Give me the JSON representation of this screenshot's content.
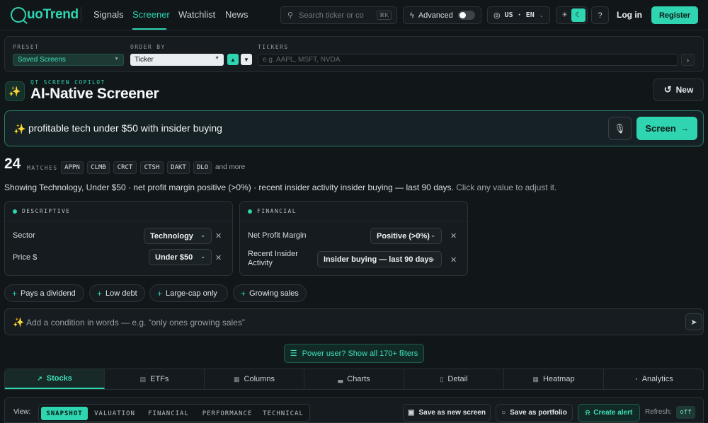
{
  "brand": {
    "logo_text": "uoTrend"
  },
  "nav": {
    "items": [
      "Signals",
      "Screener",
      "Watchlist",
      "News"
    ],
    "active": "Screener"
  },
  "search": {
    "placeholder": "Search ticker or co",
    "shortcut": "⌘K"
  },
  "advanced": {
    "label": "Advanced",
    "enabled": false
  },
  "locale": {
    "label": "US · EN"
  },
  "auth": {
    "login": "Log in",
    "register": "Register"
  },
  "presets": {
    "preset_label": "PRESET",
    "preset_value": "Saved Screens",
    "order_label": "ORDER BY",
    "order_value": "Ticker",
    "asc_glyph": "▲",
    "desc_glyph": "▼",
    "tickers_label": "TICKERS",
    "tickers_placeholder": "e.g. AAPL, MSFT, NVDA",
    "go_glyph": "›"
  },
  "copilot": {
    "eyebrow": "QT SCREEN COPILOT",
    "title": "AI-Native Screener",
    "new_label": "New"
  },
  "query": {
    "text": "profitable tech under $50 with insider buying",
    "screen_label": "Screen"
  },
  "matches": {
    "count": "24",
    "label": "MATCHES",
    "tickers": [
      "APPN",
      "CLMB",
      "CRCT",
      "CTSH",
      "DAKT",
      "DLO"
    ],
    "more": "and more"
  },
  "summary": {
    "text": "Showing Technology, Under $50 · net profit margin positive (>0%) · recent insider activity insider buying — last 90 days.",
    "hint": "Click any value to adjust it."
  },
  "filters": {
    "descriptive": {
      "title": "DESCRIPTIVE",
      "rows": [
        {
          "label": "Sector",
          "value": "Technology"
        },
        {
          "label": "Price $",
          "value": "Under $50"
        }
      ]
    },
    "financial": {
      "title": "FINANCIAL",
      "rows": [
        {
          "label": "Net Profit Margin",
          "value": "Positive (>0%)"
        },
        {
          "label": "Recent Insider Activity",
          "value": "Insider buying — last 90 days"
        }
      ]
    }
  },
  "suggestions": [
    "Pays a dividend",
    "Low debt",
    "Large-cap only",
    "Growing sales"
  ],
  "add_condition": {
    "placeholder": "Add a condition in words — e.g. “only ones growing sales”"
  },
  "power": {
    "label": "Power user? Show all 170+ filters"
  },
  "tabs": [
    "Stocks",
    "ETFs",
    "Columns",
    "Charts",
    "Detail",
    "Heatmap",
    "Analytics"
  ],
  "active_tab": "Stocks",
  "toolbar": {
    "view_label": "View:",
    "views": [
      "SNAPSHOT",
      "VALUATION",
      "FINANCIAL",
      "PERFORMANCE",
      "TECHNICAL"
    ],
    "active_view": "SNAPSHOT",
    "save_screen": "Save as new screen",
    "save_portfolio": "Save as portfolio",
    "create_alert": "Create alert",
    "refresh_label": "Refresh:",
    "refresh_value": "off"
  },
  "colors": {
    "accent": "#2fd4b0",
    "background": "#111619",
    "panel": "#151b1f"
  }
}
